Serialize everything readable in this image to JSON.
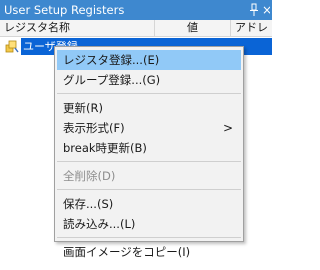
{
  "window": {
    "title": "User Setup Registers",
    "pin_icon": "pin-icon",
    "close_glyph": "×"
  },
  "table": {
    "columns": [
      "レジスタ名称",
      "値",
      "アドレ"
    ],
    "selected_row_text": "ユーザ登録"
  },
  "menu": {
    "items": [
      {
        "label": "レジスタ登録...(E)"
      },
      {
        "label": "グループ登録...(G)"
      },
      {
        "label": "更新(R)"
      },
      {
        "label": "表示形式(F)",
        "submenu_arrow": ">"
      },
      {
        "label": "break時更新(B)"
      },
      {
        "label": "全削除(D)"
      },
      {
        "label": "保存...(S)"
      },
      {
        "label": "読み込み...(L)"
      },
      {
        "label": "画面イメージをコピー(I)"
      }
    ]
  },
  "colors": {
    "titlebar": "#3e88cf",
    "selection": "#0a64d6",
    "menu_hover": "#91c9f7",
    "disabled_text": "#8d8d8d"
  }
}
